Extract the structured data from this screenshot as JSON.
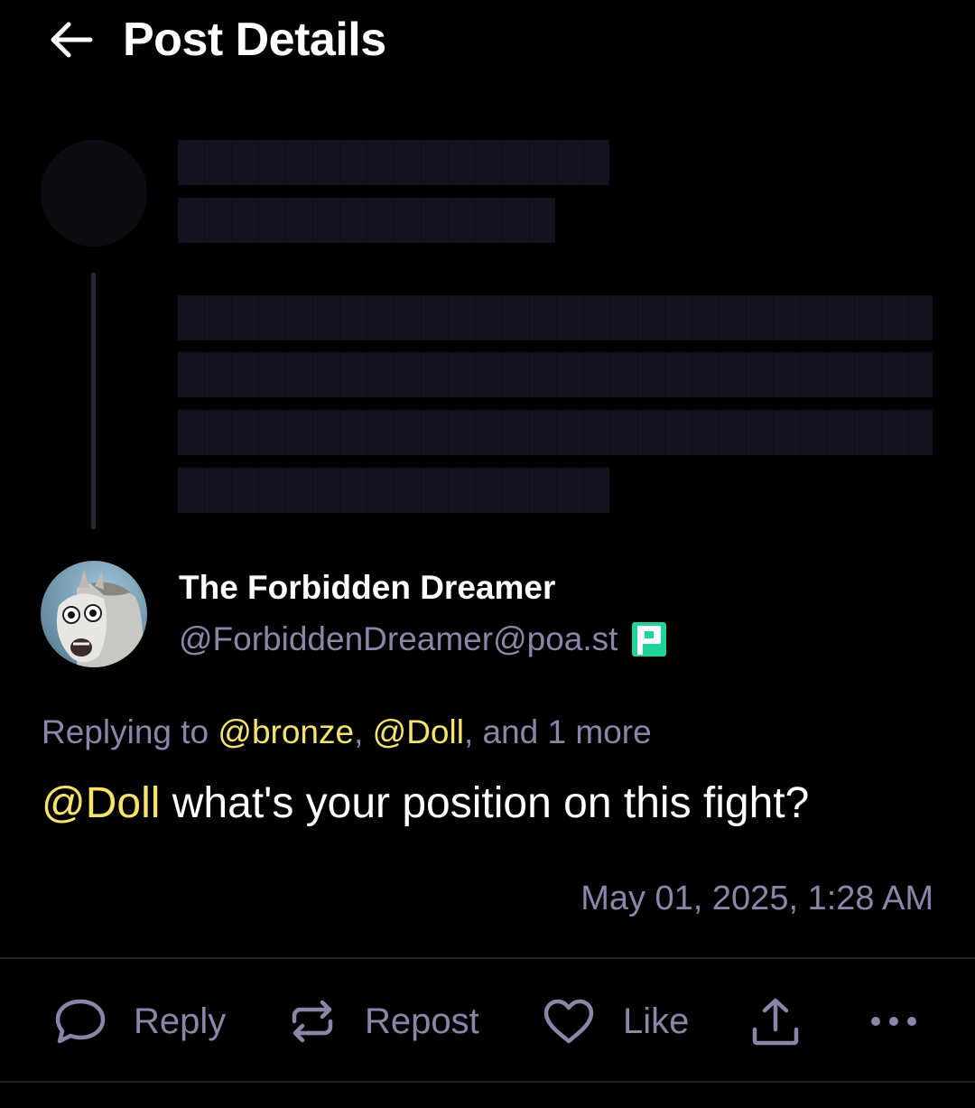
{
  "header": {
    "title": "Post Details",
    "back_icon": "arrow-left-icon"
  },
  "author": {
    "display_name": "The Forbidden Dreamer",
    "handle": "@ForbiddenDreamer@poa.st",
    "instance_icon": "pleroma-icon"
  },
  "replying": {
    "prefix": "Replying to ",
    "mentions": [
      "@bronze",
      "@Doll"
    ],
    "separator": ", ",
    "and_more": ", and 1 more"
  },
  "post": {
    "mention": "@Doll",
    "text": " what's your position on this fight?",
    "timestamp": "May 01, 2025, 1:28 AM"
  },
  "actions": {
    "reply": "Reply",
    "repost": "Repost",
    "like": "Like",
    "share_icon": "share-upload-icon",
    "more_icon": "more-horizontal-icon"
  },
  "colors": {
    "background": "#000000",
    "text_primary": "#ffffff",
    "text_muted": "#8b86a8",
    "mention": "#f6e36b",
    "skeleton": "#16111f",
    "instance_badge": "#1fd49a"
  }
}
